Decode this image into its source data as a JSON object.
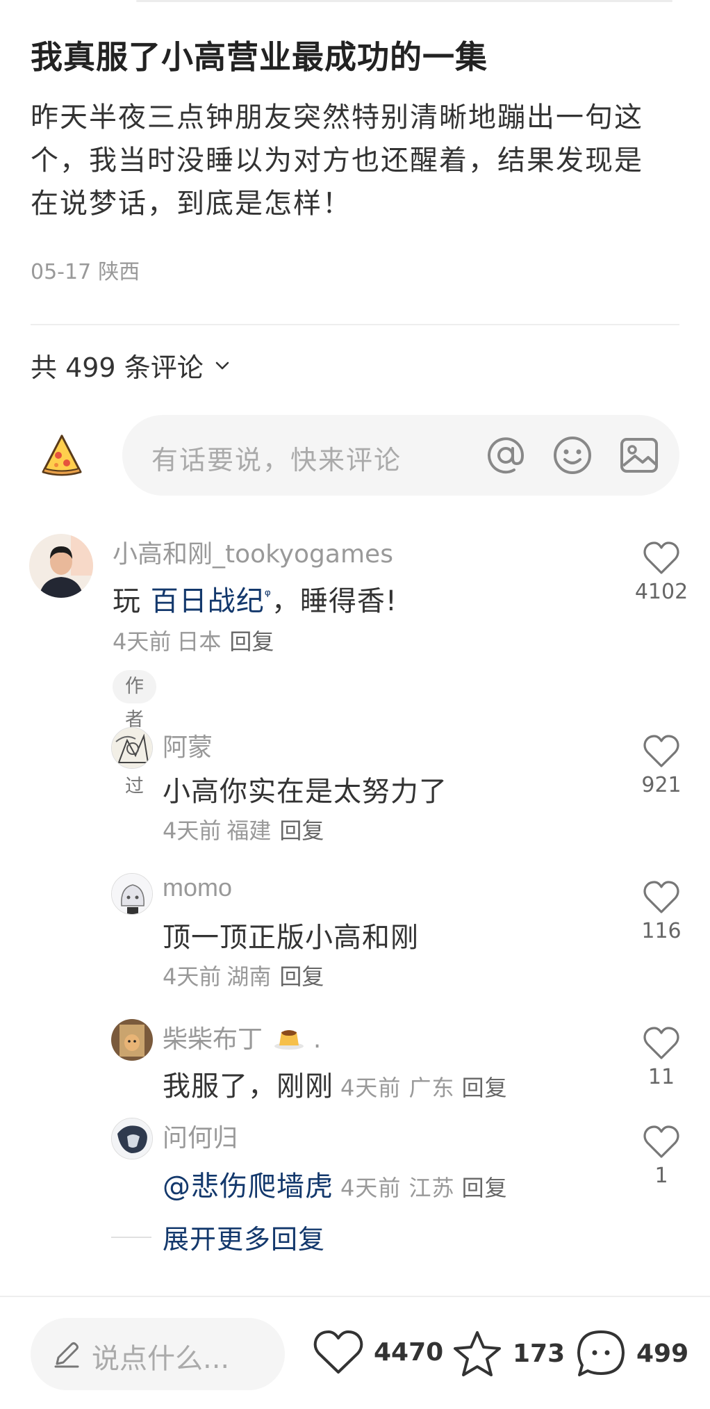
{
  "post": {
    "title": "我真服了小高营业最成功的一集",
    "body_lines": [
      "昨天半夜三点钟朋友突然特别清晰地蹦出一句这",
      "个，我当时没睡以为对方也还醒着，结果发现是",
      "在说梦话，到底是怎样！"
    ],
    "date": "05-17",
    "location": "陕西"
  },
  "comments_header": {
    "total_label": "共 499 条评论"
  },
  "composer": {
    "placeholder": "有话要说，快来评论",
    "icons": [
      "pizza-avatar-icon",
      "at-icon",
      "emoji-icon",
      "image-icon"
    ]
  },
  "comments": [
    {
      "name": "小高和刚_tookyogames",
      "text_prefix": "玩 ",
      "text_link": "百日战纪",
      "text_link_mark": "ᵠ",
      "text_suffix": "，睡得香!",
      "time": "4天前",
      "location": "日本",
      "reply": "回复",
      "badge": "作者赞过",
      "likes": "4102"
    }
  ],
  "replies": [
    {
      "name": "阿蒙",
      "text": "小高你实在是太努力了",
      "time": "4天前",
      "location": "福建",
      "reply": "回复",
      "likes": "921"
    },
    {
      "name": "momo",
      "text": "顶一顶正版小高和刚",
      "time": "4天前",
      "location": "湖南",
      "reply": "回复",
      "likes": "116"
    },
    {
      "name": "柴柴布丁",
      "name_suffix": ".",
      "text": "我服了，刚刚",
      "time": "4天前",
      "location": "广东",
      "reply": "回复",
      "likes": "11"
    },
    {
      "name": "问何归",
      "text": "@悲伤爬墙虎",
      "time": "4天前",
      "location": "江苏",
      "reply": "回复",
      "likes": "1"
    }
  ],
  "expand_more": "展开更多回复",
  "bottom_bar": {
    "say_placeholder": "说点什么...",
    "likes": "4470",
    "favorites": "173",
    "comments": "499"
  },
  "colors": {
    "link": "#13386c",
    "accent_red": "#ff2442",
    "muted_text": "#999999"
  }
}
